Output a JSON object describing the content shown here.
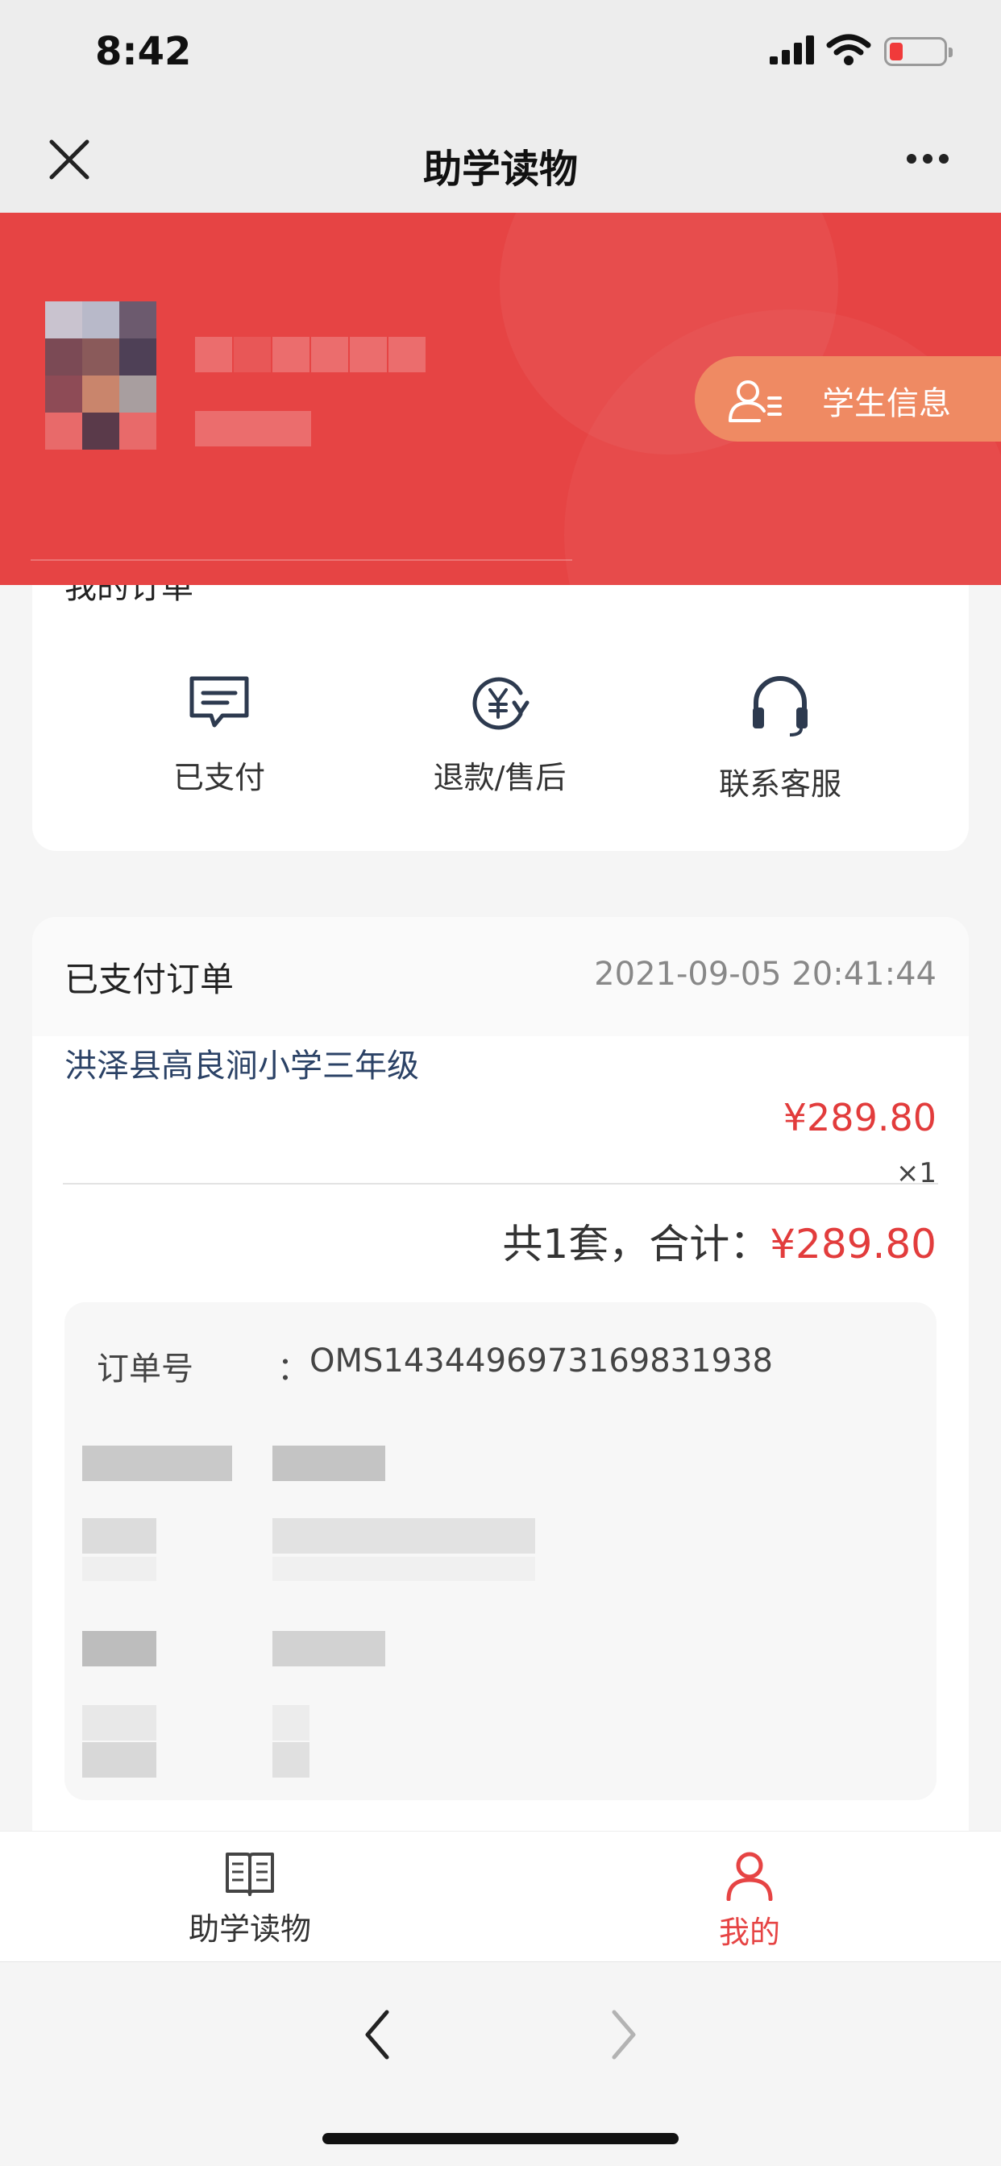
{
  "status_bar": {
    "time": "8:42"
  },
  "nav": {
    "title": "助学读物"
  },
  "header": {
    "student_info_label": "学生信息",
    "section_peek": "我的订单",
    "accent_color": "#e64444"
  },
  "shortcuts": [
    {
      "label": "已支付",
      "icon": "message-icon"
    },
    {
      "label": "退款/售后",
      "icon": "yuan-refund-icon"
    },
    {
      "label": "联系客服",
      "icon": "headset-icon"
    }
  ],
  "order": {
    "title": "已支付订单",
    "datetime": "2021-09-05 20:41:44",
    "school": "洪泽县高良涧小学三年级",
    "price": "¥289.80",
    "quantity": "×1",
    "total_prefix": "共1套，合计：",
    "total_amount": "¥289.80",
    "order_no_label": "订单号",
    "order_no_colon": "：",
    "order_no": "OMS1434496973169831938"
  },
  "tabbar": {
    "items": [
      {
        "label": "助学读物",
        "icon": "book-icon",
        "active": false
      },
      {
        "label": "我的",
        "icon": "person-icon",
        "active": true
      }
    ],
    "active_color": "#e64444"
  }
}
